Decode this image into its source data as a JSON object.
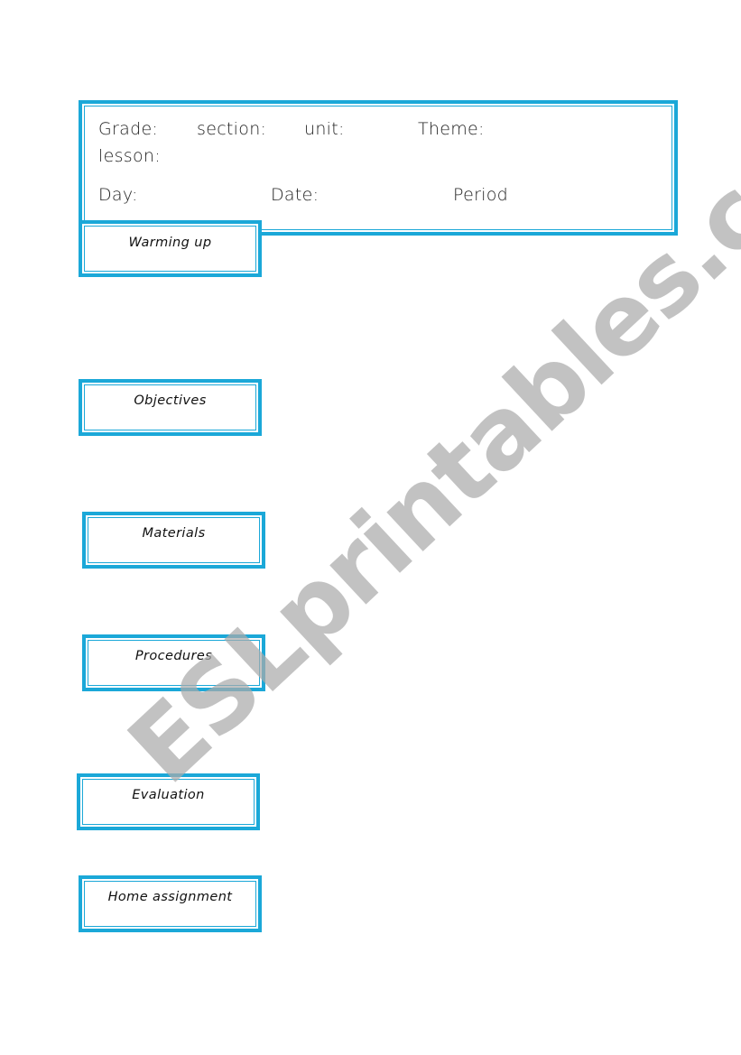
{
  "header": {
    "grade_label": "Grade:",
    "section_label": "section:",
    "unit_label": "unit:",
    "theme_label": "Theme:",
    "lesson_label": "lesson:",
    "day_label": "Day:",
    "date_label": "Date:",
    "period_label": "Period"
  },
  "sections": [
    {
      "label": "Warming up"
    },
    {
      "label": "Objectives"
    },
    {
      "label": "Materials"
    },
    {
      "label": "Procedures"
    },
    {
      "label": "Evaluation"
    },
    {
      "label": "Home assignment"
    }
  ],
  "watermark": {
    "text": "ESLprintables.com"
  },
  "colors": {
    "border": "#1ba8d8",
    "watermark": "#aaaaaa"
  }
}
